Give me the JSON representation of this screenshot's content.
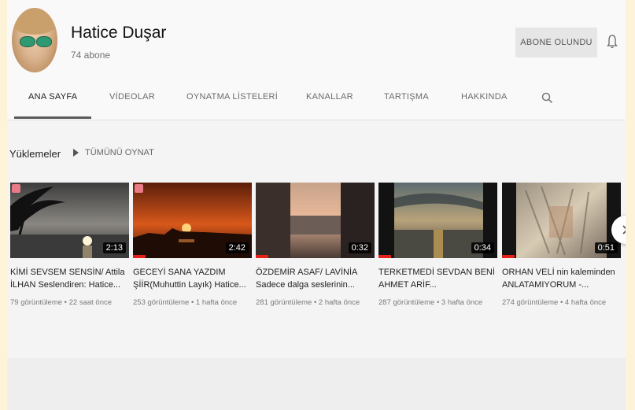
{
  "channel": {
    "name": "Hatice Duşar",
    "subscribers": "74 abone",
    "subscribe_label": "ABONE OLUNDU"
  },
  "tabs": [
    {
      "label": "ANA SAYFA",
      "active": true
    },
    {
      "label": "VİDEOLAR"
    },
    {
      "label": "OYNATMA LİSTELERİ"
    },
    {
      "label": "KANALLAR"
    },
    {
      "label": "TARTIŞMA"
    },
    {
      "label": "HAKKINDA"
    }
  ],
  "section": {
    "title": "Yüklemeler",
    "play_all": "TÜMÜNÜ OYNAT"
  },
  "videos": [
    {
      "title": "KİMİ SEVSEM SENSİN/ Attila İLHAN Seslendiren: Hatice...",
      "duration": "2:13",
      "meta": "79 görüntüleme • 22 saat önce"
    },
    {
      "title": "GECEYİ SANA YAZDIM ŞİİR(Muhuttin Layık) Hatice...",
      "duration": "2:42",
      "meta": "253 görüntüleme • 1 hafta önce"
    },
    {
      "title": "ÖZDEMİR ASAF/ LAVİNİA Sadece dalga seslerinin...",
      "duration": "0:32",
      "meta": "281 görüntüleme • 2 hafta önce"
    },
    {
      "title": "TERKETMEDİ SEVDAN BENİ AHMET ARİF...",
      "duration": "0:34",
      "meta": "287 görüntüleme • 3 hafta önce"
    },
    {
      "title": "ORHAN VELİ nin kaleminden ANLATAMIYORUM -...",
      "duration": "0:51",
      "meta": "274 görüntüleme • 4 hafta önce"
    }
  ],
  "icons": {
    "bell": "bell-icon",
    "search": "search-icon",
    "play": "play-icon",
    "next": "chevron-right-icon"
  },
  "colors": {
    "progress": "#e62117",
    "background": "#f4f4f4"
  }
}
